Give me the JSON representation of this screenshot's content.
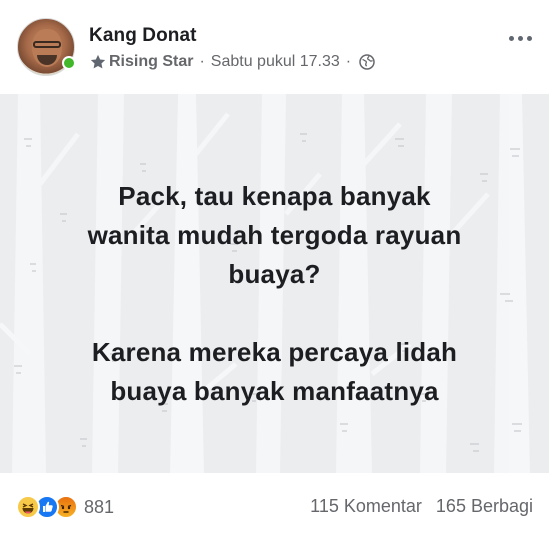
{
  "post": {
    "author": "Kang Donat",
    "badge": "Rising Star",
    "separator": "·",
    "timestamp": "Sabtu pukul 17.33",
    "audience_icon": "globe-icon",
    "text_lines": [
      "Pack, tau kenapa banyak",
      "wanita mudah tergoda rayuan",
      "buaya?",
      "",
      "Karena mereka percaya lidah",
      "buaya banyak manfaatnya"
    ],
    "background_color": "#ecedef"
  },
  "footer": {
    "reactions": [
      "haha",
      "like",
      "angry"
    ],
    "reaction_count": "881",
    "comments": "115 Komentar",
    "shares": "165 Berbagi"
  },
  "colors": {
    "online": "#42b72a",
    "like": "#1877f2",
    "text": "#1c1e21",
    "meta": "#65676b"
  }
}
